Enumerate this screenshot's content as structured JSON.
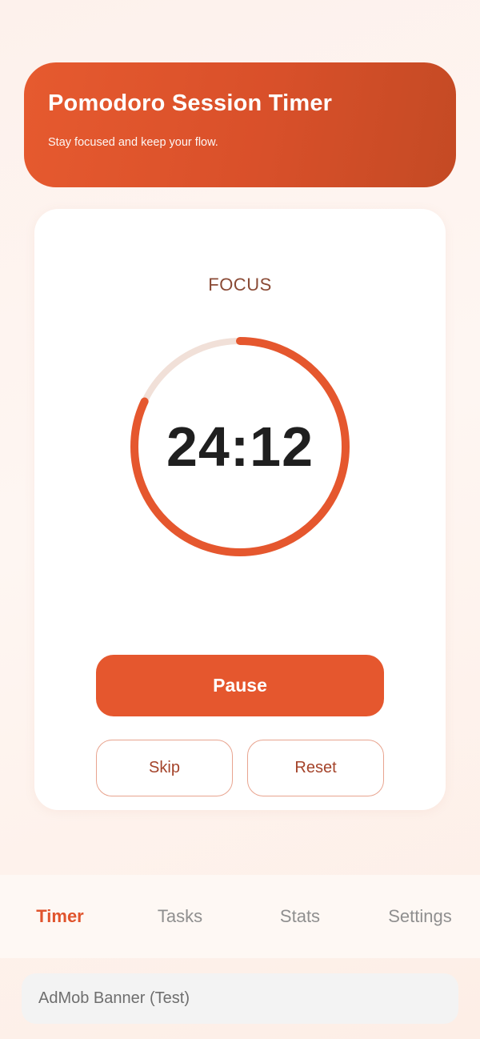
{
  "header": {
    "title": "Pomodoro Session Timer",
    "subtitle": "Stay focused and keep your flow."
  },
  "timer": {
    "mode_label": "FOCUS",
    "time": "24:12",
    "progress_fraction": 0.82,
    "colors": {
      "progress": "#e5572e",
      "track": "#f1e0d8"
    }
  },
  "controls": {
    "primary_label": "Pause",
    "skip_label": "Skip",
    "reset_label": "Reset"
  },
  "tabs": [
    {
      "label": "Timer",
      "active": true
    },
    {
      "label": "Tasks",
      "active": false
    },
    {
      "label": "Stats",
      "active": false
    },
    {
      "label": "Settings",
      "active": false
    }
  ],
  "ad": {
    "label": "AdMob Banner (Test)"
  },
  "colors": {
    "accent": "#e5572e",
    "background": "#fdf1ec"
  }
}
